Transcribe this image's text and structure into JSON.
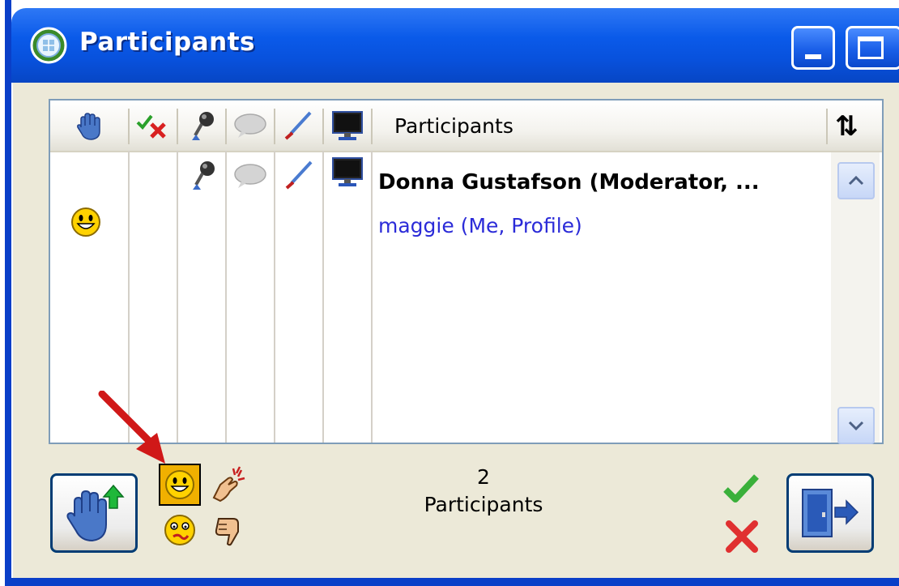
{
  "window": {
    "title": "Participants",
    "controls": [
      "minimize",
      "maximize"
    ]
  },
  "list": {
    "header": {
      "icons": [
        "raise-hand",
        "approve-deny",
        "microphone",
        "chat",
        "pen",
        "desktop"
      ],
      "label": "Participants",
      "sort_icon": "⇅"
    },
    "rows": [
      {
        "name": "Donna Gustafson (Moderator, ...",
        "style": "bold",
        "icons": [
          "microphone",
          "chat",
          "pen",
          "desktop"
        ]
      },
      {
        "name": "maggie (Me, Profile)",
        "style": "link",
        "status": "smile"
      }
    ]
  },
  "footer": {
    "count": "2",
    "count_label": "Participants"
  },
  "colors": {
    "titlebar": "#0a5ae9",
    "frame": "#0a3fc8",
    "client": "#ece9d8",
    "link": "#2b2bd8",
    "arrow": "#d01818"
  }
}
